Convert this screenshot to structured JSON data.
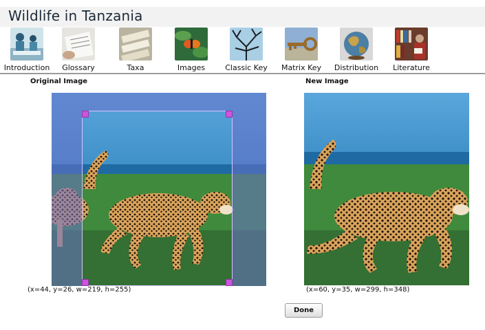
{
  "header": {
    "title": "Wildlife in Tanzania"
  },
  "nav": {
    "items": [
      {
        "label": "Introduction",
        "icon": "introduction-icon"
      },
      {
        "label": "Glossary",
        "icon": "glossary-icon"
      },
      {
        "label": "Taxa",
        "icon": "taxa-icon"
      },
      {
        "label": "Images",
        "icon": "images-icon"
      },
      {
        "label": "Classic Key",
        "icon": "classic-key-icon"
      },
      {
        "label": "Matrix Key",
        "icon": "matrix-key-icon"
      },
      {
        "label": "Distribution",
        "icon": "distribution-icon"
      },
      {
        "label": "Literature",
        "icon": "literature-icon"
      }
    ]
  },
  "original": {
    "heading": "Original Image",
    "coords": "(x=44, y=26, w=219, h=255)"
  },
  "new_image": {
    "heading": "New Image",
    "coords": "(x=60, y=35, w=299, h=348)"
  },
  "actions": {
    "done_label": "Done"
  },
  "colors": {
    "title_bar": "#f2f2f2",
    "crop_handle": "#cc55dd",
    "sky": "#4aa6da",
    "grass": "#3f8a3c",
    "overlay": "#6a6fc8"
  }
}
